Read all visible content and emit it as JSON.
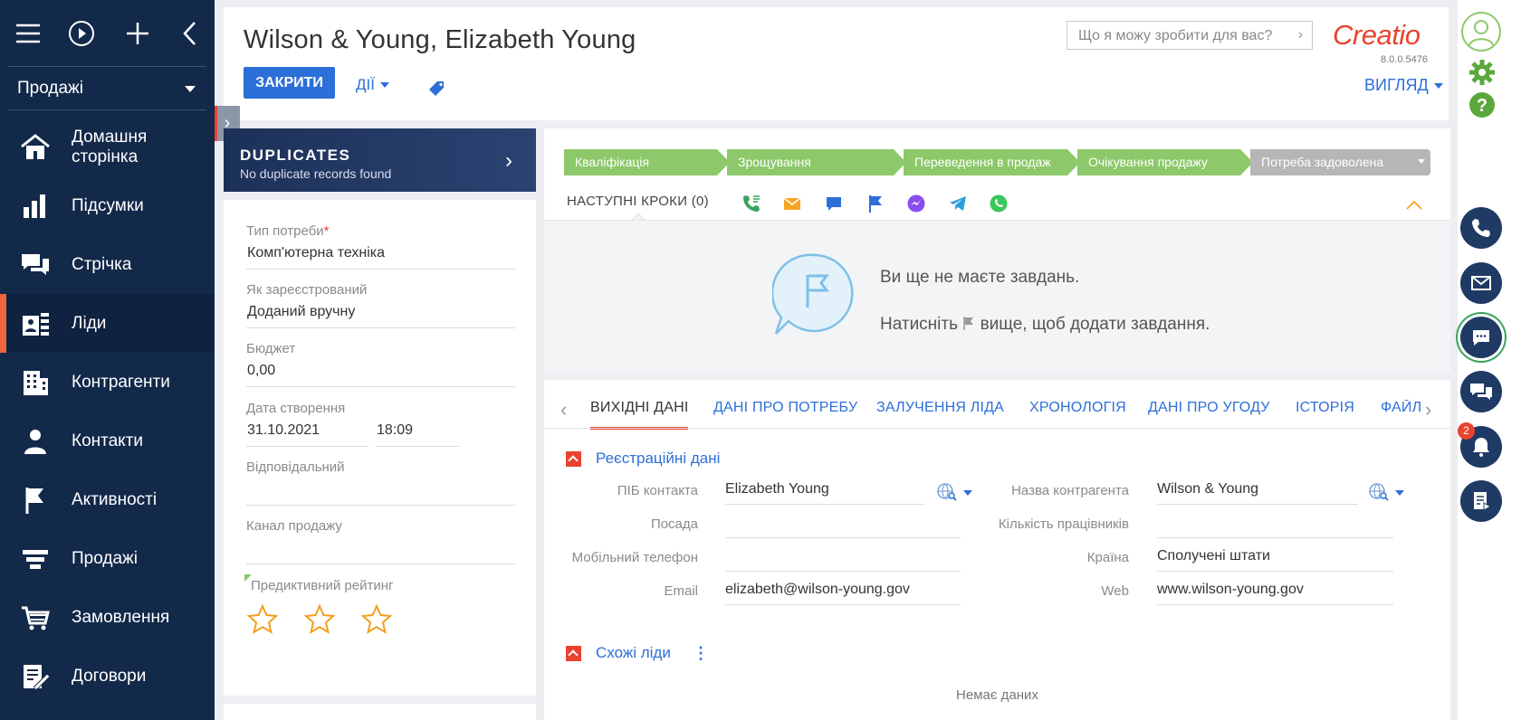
{
  "sidebar": {
    "workspace": "Продажі",
    "items": [
      {
        "label": "Домашня сторінка",
        "icon": "home-icon"
      },
      {
        "label": "Підсумки",
        "icon": "bar-chart-icon"
      },
      {
        "label": "Стрічка",
        "icon": "chat-feed-icon"
      },
      {
        "label": "Ліди",
        "icon": "leads-icon",
        "active": true
      },
      {
        "label": "Контрагенти",
        "icon": "building-icon"
      },
      {
        "label": "Контакти",
        "icon": "person-icon"
      },
      {
        "label": "Активності",
        "icon": "flag-icon"
      },
      {
        "label": "Продажі",
        "icon": "funnel-icon"
      },
      {
        "label": "Замовлення",
        "icon": "cart-icon"
      },
      {
        "label": "Договори",
        "icon": "contract-icon"
      }
    ]
  },
  "header": {
    "title": "Wilson & Young, Elizabeth Young",
    "close_label": "ЗАКРИТИ",
    "actions_label": "ДІЇ",
    "search_placeholder": "Що я можу зробити для вас?",
    "logo": "Creatio",
    "version": "8.0.0.5476",
    "view_label": "ВИГЛЯД"
  },
  "duplicates": {
    "title": "DUPLICATES",
    "subtitle": "No duplicate records found"
  },
  "left_form": {
    "need_type_label": "Тип потреби",
    "need_type_value": "Комп'ютерна техніка",
    "registered_label": "Як зареєстрований",
    "registered_value": "Доданий вручну",
    "budget_label": "Бюджет",
    "budget_value": "0,00",
    "created_label": "Дата створення",
    "created_date": "31.10.2021",
    "created_time": "18:09",
    "owner_label": "Відповідальний",
    "owner_value": "",
    "channel_label": "Канал продажу",
    "channel_value": "",
    "rating_label": "Предиктивний рейтинг",
    "rating_stars": 3
  },
  "stages": [
    "Кваліфікація",
    "Зрощування",
    "Переведення в продаж",
    "Очікування продажу",
    "Потреба задоволена"
  ],
  "next_steps": {
    "title": "НАСТУПНІ КРОКИ (0)",
    "empty_line1": "Ви ще не маєте завдань.",
    "empty_line2_before": "Натисніть",
    "empty_line2_after": "вище, щоб додати завдання."
  },
  "tabs": [
    "ВИХІДНІ ДАНІ",
    "ДАНІ ПРО ПОТРЕБУ",
    "ЗАЛУЧЕННЯ ЛІДА",
    "ХРОНОЛОГІЯ",
    "ДАНІ ПРО УГОДУ",
    "ІСТОРІЯ",
    "ФАЙЛ"
  ],
  "registration": {
    "title": "Реєстраційні дані",
    "contact_label": "ПІБ контакта",
    "contact_value": "Elizabeth Young",
    "position_label": "Посада",
    "position_value": "",
    "mobile_label": "Мобільний телефон",
    "mobile_value": "",
    "email_label": "Email",
    "email_value": "elizabeth@wilson-young.gov",
    "account_label": "Назва контрагента",
    "account_value": "Wilson & Young",
    "employees_label": "Кількість працівників",
    "employees_value": "",
    "country_label": "Країна",
    "country_value": "Сполучені штати",
    "web_label": "Web",
    "web_value": "www.wilson-young.gov"
  },
  "similar": {
    "title": "Схожі ліди",
    "empty": "Немає даних"
  },
  "right_bar": {
    "notification_count": "2"
  },
  "colors": {
    "sidebar": "#13294a",
    "accent": "#2d6fd8",
    "brand": "#e8432f",
    "stage_done": "#8dc86a",
    "stage_pending": "#b6b6b6"
  }
}
